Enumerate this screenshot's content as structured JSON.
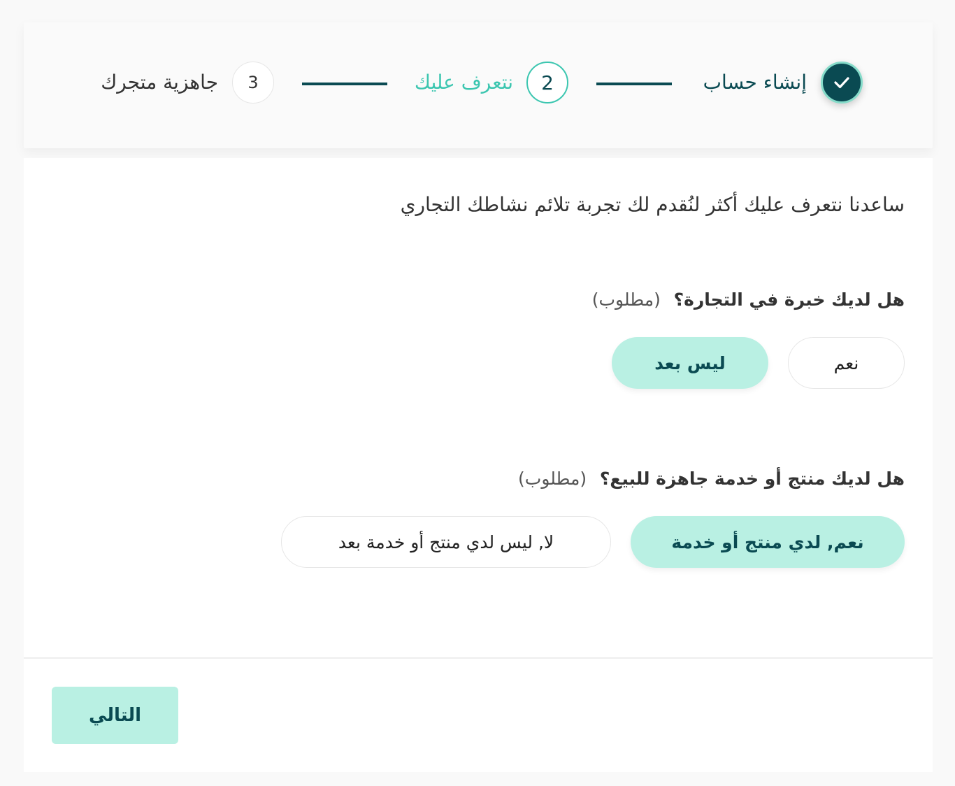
{
  "stepper": {
    "steps": [
      {
        "label": "إنشاء حساب",
        "state": "done",
        "icon": "check-icon"
      },
      {
        "label": "نتعرف عليك",
        "number": "2",
        "state": "active"
      },
      {
        "label": "جاهزية متجرك",
        "number": "3",
        "state": "pending"
      }
    ]
  },
  "form": {
    "intro": "ساعدنا نتعرف عليك أكثر لنُقدم لك تجربة تلائم نشاطك التجاري",
    "questions": [
      {
        "text": "هل لديك خبرة في التجارة؟",
        "required_label": "(مطلوب)",
        "options": [
          {
            "label": "نعم",
            "selected": false
          },
          {
            "label": "ليس بعد",
            "selected": true
          }
        ]
      },
      {
        "text": "هل لديك منتج أو خدمة جاهزة للبيع؟",
        "required_label": "(مطلوب)",
        "options": [
          {
            "label": "نعم, لدي منتج أو خدمة",
            "selected": true
          },
          {
            "label": "لا, ليس لدي منتج أو خدمة بعد",
            "selected": false
          }
        ]
      }
    ]
  },
  "footer": {
    "next_label": "التالي"
  },
  "colors": {
    "primary_dark": "#0a4a52",
    "accent": "#3cc6b0",
    "selected_bg": "#b9f0e3"
  }
}
